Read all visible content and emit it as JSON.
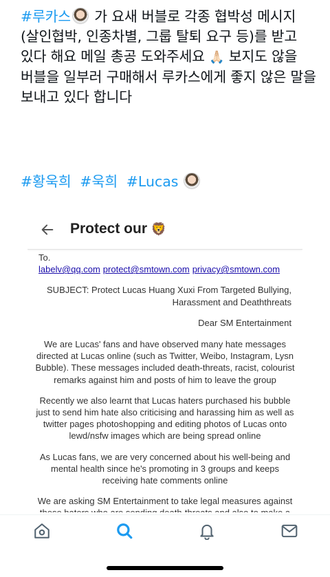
{
  "tweet": {
    "hashtag_lead": "#루카스",
    "avatar_icon": "lucas-avatar-emoji",
    "text_part1": " 가 요새 버블로 각종 협박성 메시지(살인협박, 인종차별, 그룹 탈퇴 요구 등)를 받고 있다 해요 메일 총공 도와주세요 ",
    "pray_emoji": "🙏🏻",
    "text_part2": " 보지도 않을 버블을 일부러 구매해서 루카스에게 좋지 않은 말을 보내고 있다 합니다",
    "hashtags": [
      "#황욱희",
      "#욱희",
      "#Lucas"
    ],
    "accent_color": "#1d9bf0"
  },
  "email": {
    "title": "Protect our",
    "title_emoji": "🦁",
    "to_label": "To.",
    "recipients": [
      "labelv@qq.com",
      "protect@smtown.com",
      "privacy@smtown.com"
    ],
    "subject": "SUBJECT: Protect Lucas Huang Xuxi From Targeted Bullying, Harassment and Deaththreats",
    "greeting": "Dear SM Entertainment",
    "paragraphs": [
      "We are Lucas' fans and have observed many hate messages directed at Lucas online (such as Twitter, Weibo, Instagram, Lysn Bubble). These messages included death-threats, racist, colourist remarks against him and posts of him to leave the group",
      "Recently we also learnt that Lucas haters purchased his bubble just to send him hate also criticising and harassing him as well as twitter pages photoshopping and editing photos of Lucas onto lewd/nsfw images which are being spread online",
      "As Lucas fans, we are very concerned about his well-being and mental health since he's promoting in 3 groups and keeps receiving hate comments online",
      "We are asking SM Entertainment to take legal measures against these haters who are sending death-threats and also to make a public stand to protect Lucas against online harassment and"
    ]
  },
  "nav": {
    "items": [
      "home-icon",
      "search-icon",
      "notifications-icon",
      "messages-icon"
    ],
    "active_color": "#1d9bf0",
    "inactive_color": "#536471"
  }
}
